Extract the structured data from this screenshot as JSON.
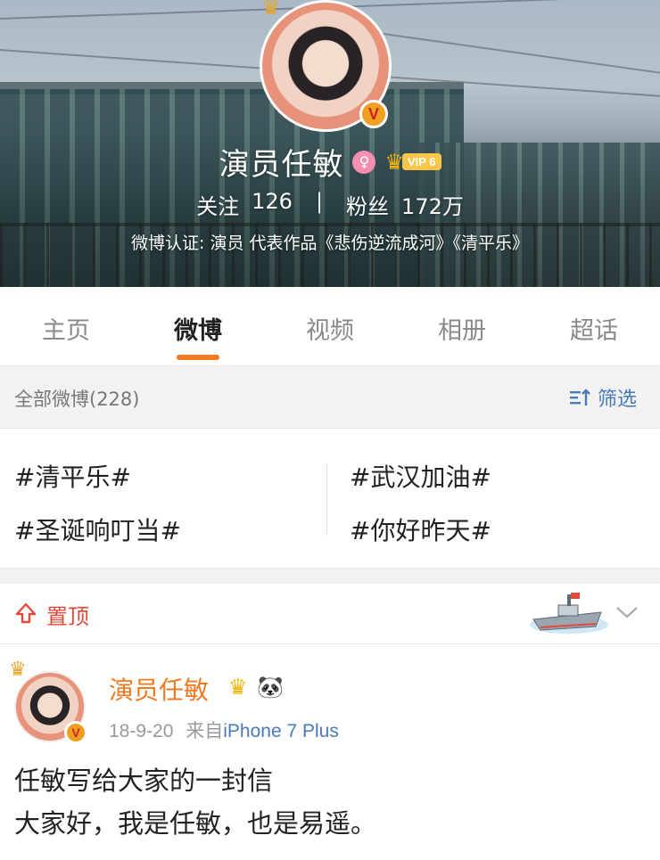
{
  "profile": {
    "name": "演员任敏",
    "vip_level": "VIP 6",
    "verified_mark": "V",
    "stats": {
      "following_label": "关注",
      "following_value": "126",
      "separator": "|",
      "followers_label": "粉丝",
      "followers_value": "172万"
    },
    "verification": "微博认证: 演员 代表作品《悲伤逆流成河》《清平乐》"
  },
  "tabs": [
    {
      "label": "主页",
      "active": false
    },
    {
      "label": "微博",
      "active": true
    },
    {
      "label": "视频",
      "active": false
    },
    {
      "label": "相册",
      "active": false
    },
    {
      "label": "超话",
      "active": false
    }
  ],
  "filter": {
    "count_label": "全部微博(228)",
    "filter_label": "筛选"
  },
  "topics": [
    "#清平乐#",
    "#武汉加油#",
    "#圣诞响叮当#",
    "#你好昨天#"
  ],
  "pinned": {
    "label": "置顶"
  },
  "post": {
    "author": "演员任敏",
    "date": "18-9-20",
    "source_prefix": "来自",
    "source": "iPhone 7 Plus",
    "lines": [
      "任敏写给大家的一封信",
      "大家好，我是任敏，也是易遥。"
    ]
  },
  "colors": {
    "accent_orange": "#f47c20",
    "link_blue": "#4a7ab8",
    "pin_red": "#e14a3a",
    "vip_gold": "#f4b400"
  },
  "icons": [
    "gender-female-icon",
    "vip-crown-icon",
    "filter-icon",
    "pin-top-icon",
    "ship-icon",
    "chevron-down-icon",
    "panda-icon",
    "verified-icon"
  ]
}
